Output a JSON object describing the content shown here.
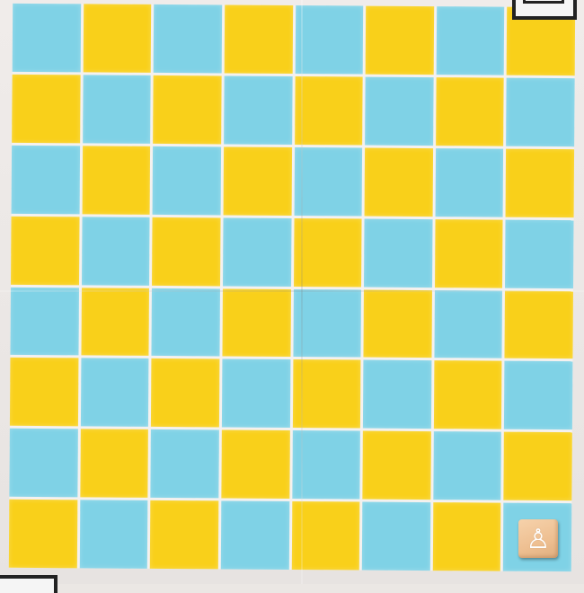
{
  "board": {
    "rows": 8,
    "cols": 8,
    "colors": {
      "yellow": "#f9d01a",
      "blue": "#7fd2e6"
    },
    "top_left_color": "blue"
  },
  "pieces": [
    {
      "icon": "white-pawn-icon",
      "glyph": "♙",
      "row": 8,
      "col": 8,
      "block_color": "#f1c89e"
    }
  ],
  "markers": [
    {
      "name": "fiducial-marker-top-right"
    },
    {
      "name": "fiducial-marker-bottom-left"
    }
  ]
}
